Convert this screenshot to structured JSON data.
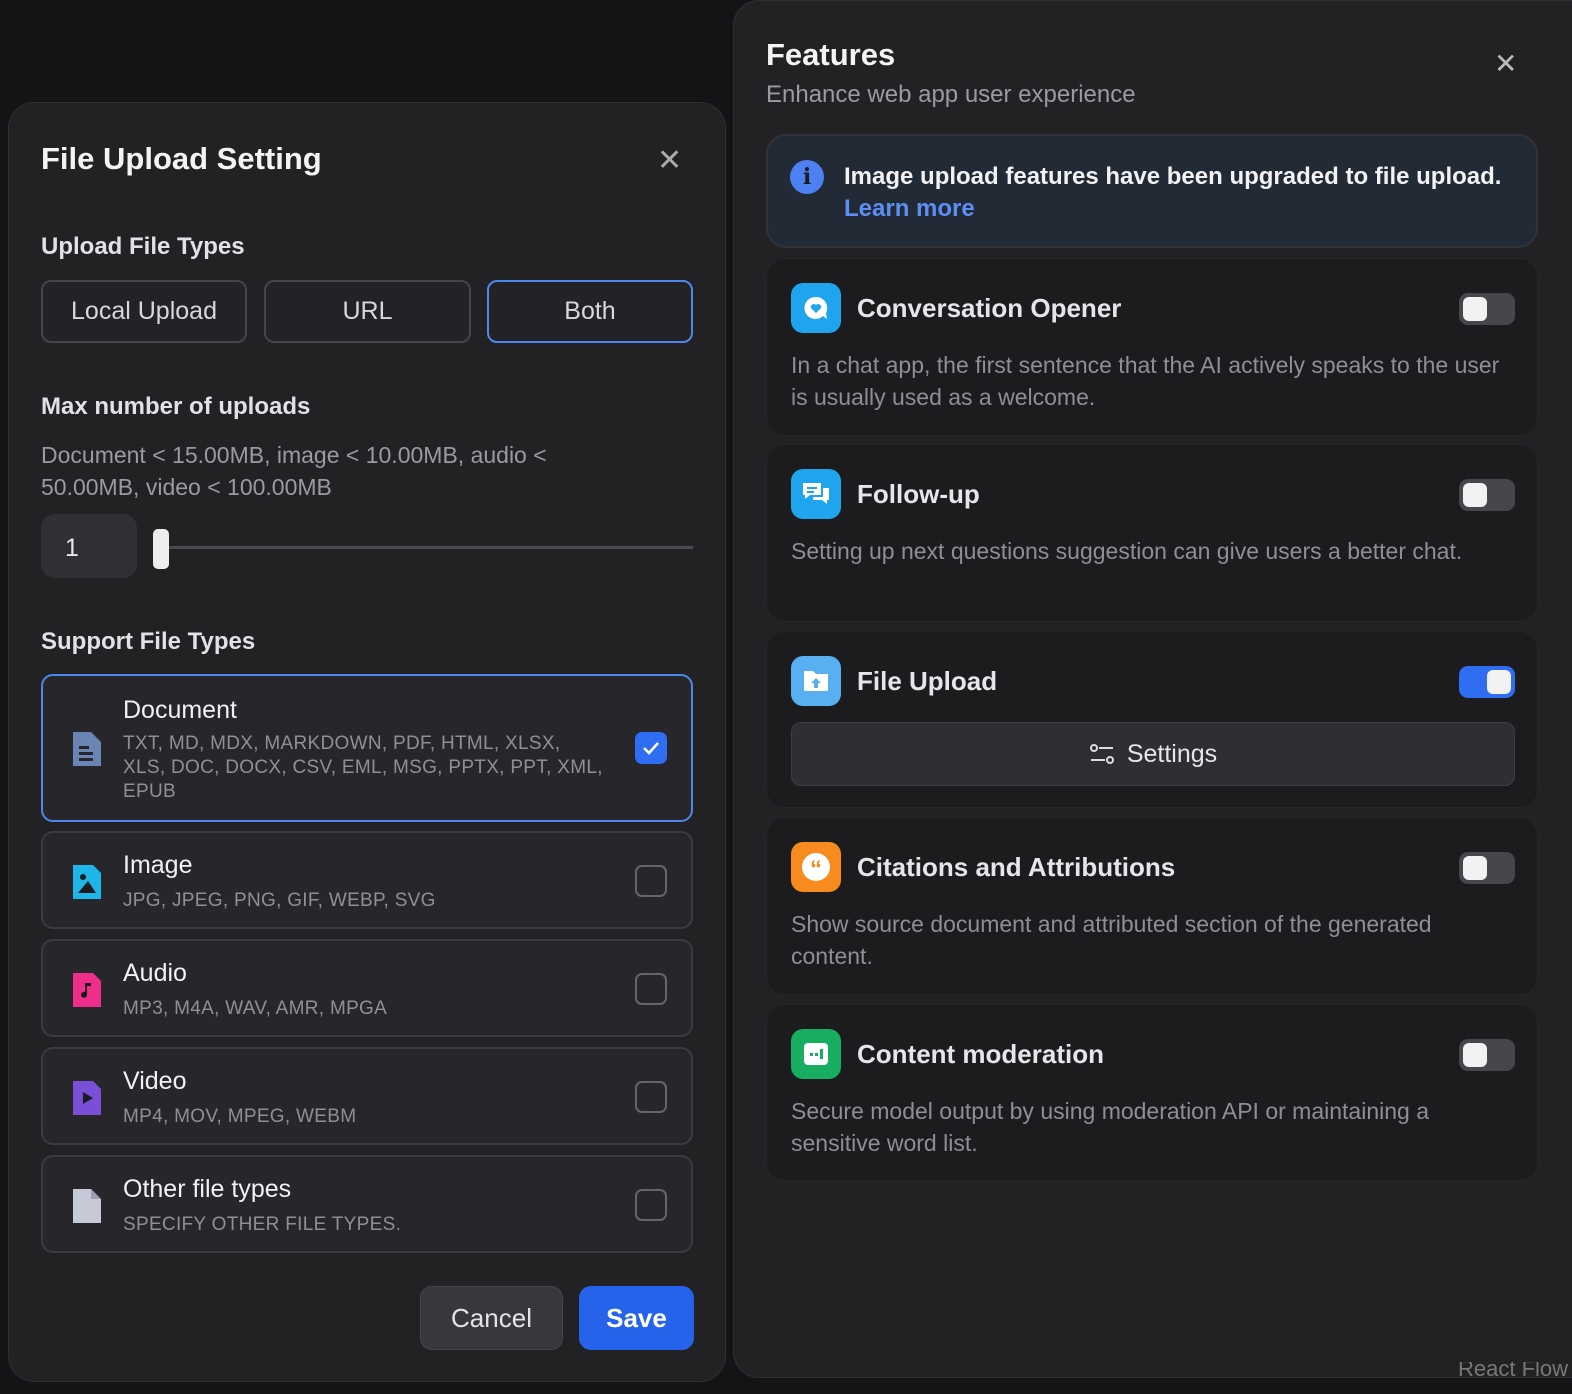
{
  "modal": {
    "title": "File Upload Setting",
    "upload_types_label": "Upload File Types",
    "upload_options": [
      "Local Upload",
      "URL",
      "Both"
    ],
    "selected_upload_option": "Both",
    "max_label": "Max number of uploads",
    "limits_text": "Document < 15.00MB, image < 10.00MB, audio < 50.00MB, video < 100.00MB",
    "max_value": "1",
    "slider_fraction": 0,
    "support_label": "Support File Types",
    "types": [
      {
        "name": "Document",
        "desc": "TXT, MD, MDX, MARKDOWN, PDF, HTML, XLSX, XLS, DOC, DOCX, CSV, EML, MSG, PPTX, PPT, XML, EPUB",
        "checked": true,
        "color": "#6a85b3"
      },
      {
        "name": "Image",
        "desc": "JPG, JPEG, PNG, GIF, WEBP, SVG",
        "checked": false,
        "color": "#1fb5e8"
      },
      {
        "name": "Audio",
        "desc": "MP3, M4A, WAV, AMR, MPGA",
        "checked": false,
        "color": "#ee2e8a"
      },
      {
        "name": "Video",
        "desc": "MP4, MOV, MPEG, WEBM",
        "checked": false,
        "color": "#7a4fd8"
      },
      {
        "name": "Other file types",
        "desc": "SPECIFY OTHER FILE TYPES.",
        "checked": false,
        "color": "#c5cad6"
      }
    ],
    "cancel": "Cancel",
    "save": "Save"
  },
  "features": {
    "title": "Features",
    "subtitle": "Enhance web app user experience",
    "notice": "Image upload features have been upgraded to file upload.",
    "learn_more": "Learn more",
    "items": [
      {
        "title": "Conversation Opener",
        "desc": "In a chat app, the first sentence that the AI actively speaks to the user is usually used as a welcome.",
        "enabled": false,
        "color": "#1fa5ee"
      },
      {
        "title": "Follow-up",
        "desc": "Setting up next questions suggestion can give users a better chat.",
        "enabled": false,
        "color": "#1fa5ee"
      },
      {
        "title": "File Upload",
        "settings": "Settings",
        "enabled": true,
        "color": "#58b0f0"
      },
      {
        "title": "Citations and Attributions",
        "desc": "Show source document and attributed section of the generated content.",
        "enabled": false,
        "color": "#f78b1e"
      },
      {
        "title": "Content moderation",
        "desc": "Secure model output by using moderation API or maintaining a sensitive word list.",
        "enabled": false,
        "color": "#18ae62"
      }
    ]
  },
  "footer": {
    "watermark": "React Flow"
  }
}
